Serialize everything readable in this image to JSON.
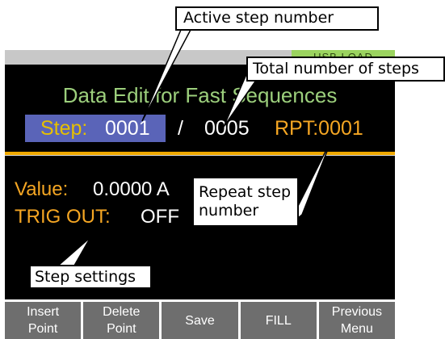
{
  "status": {
    "indicator_text": "USB LOAD"
  },
  "screen": {
    "title": "Data Edit for Fast Sequences",
    "step_label": "Step:",
    "step_value": "0001",
    "step_separator": "/",
    "step_total": "0005",
    "repeat": "RPT:0001",
    "value_label": "Value:",
    "value_amount": "0.0000 A",
    "trig_label": "TRIG OUT:",
    "trig_value": "OFF"
  },
  "softkeys": [
    {
      "label": "Insert\nPoint"
    },
    {
      "label": "Delete\nPoint"
    },
    {
      "label": "Save"
    },
    {
      "label": "FILL"
    },
    {
      "label": "Previous\nMenu"
    }
  ],
  "callouts": {
    "active_step": "Active step number",
    "total_steps": "Total number of steps",
    "repeat_step": "Repeat step\nnumber",
    "step_settings": "Step settings"
  },
  "colors": {
    "title_green": "#9ccf7c",
    "label_orange": "#f5a623",
    "step_yellow": "#e6c000",
    "step_highlight": "#5a64b8",
    "softkey_gray": "#6e6e6e",
    "status_green": "#9bd35f"
  }
}
